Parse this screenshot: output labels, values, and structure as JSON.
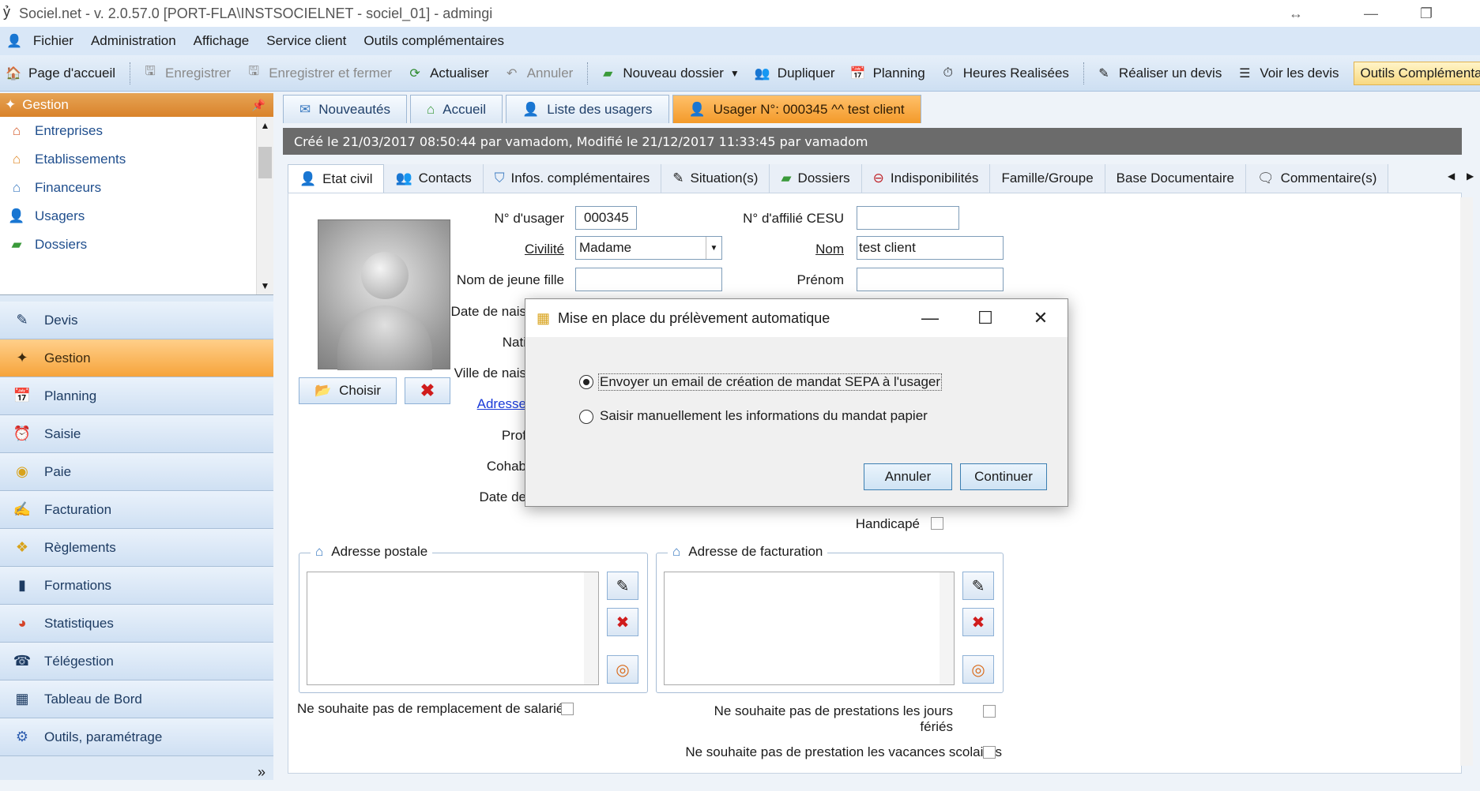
{
  "window": {
    "title": "Sociel.net - v. 2.0.57.0 [PORT-FLA\\INSTSOCIELNET - sociel_01] - admingi"
  },
  "menu": [
    "Fichier",
    "Administration",
    "Affichage",
    "Service client",
    "Outils complémentaires"
  ],
  "toolbar": {
    "home": "Page d'accueil",
    "save": "Enregistrer",
    "save_close": "Enregistrer et fermer",
    "refresh": "Actualiser",
    "cancel": "Annuler",
    "new_folder": "Nouveau dossier",
    "duplicate": "Dupliquer",
    "planning": "Planning",
    "hours": "Heures Realisées",
    "make_quote": "Réaliser un devis",
    "see_quotes": "Voir les devis",
    "tools": "Outils Complémentaires"
  },
  "sidebar": {
    "header": "Gestion",
    "items": [
      "Entreprises",
      "Etablissements",
      "Financeurs",
      "Usagers",
      "Dossiers"
    ],
    "nav": [
      "Devis",
      "Gestion",
      "Planning",
      "Saisie",
      "Paie",
      "Facturation",
      "Règlements",
      "Formations",
      "Statistiques",
      "Télégestion",
      "Tableau de Bord",
      "Outils, paramétrage"
    ],
    "active_nav": "Gestion"
  },
  "doc_tabs": [
    "Nouveautés",
    "Accueil",
    "Liste des usagers",
    "Usager N°: 000345 ^^ test client"
  ],
  "info_bar": "Créé le 21/03/2017 08:50:44 par vamadom, Modifié le 21/12/2017 11:33:45 par vamadom",
  "sub_tabs": [
    "Etat civil",
    "Contacts",
    "Infos. complémentaires",
    "Situation(s)",
    "Dossiers",
    "Indisponibilités",
    "Famille/Groupe",
    "Base Documentaire",
    "Commentaire(s)"
  ],
  "form": {
    "num_label": "N° d'usager",
    "num_value": "000345",
    "cesu_label": "N° d'affilié CESU",
    "cesu_value": "",
    "civ_label": "Civilité",
    "civ_value": "Madame",
    "nom_label": "Nom",
    "nom_value": "test client",
    "jf_label": "Nom de jeune fille",
    "prenom_label": "Prénom",
    "date_naiss_label": "Date de nais",
    "nat_label": "Nati",
    "ville_label": "Ville de nais",
    "adresse_link": "Adresse",
    "prof_label": "Prof",
    "cohab_label": "Cohab",
    "date_label": "Date de",
    "handicape_label": "Handicapé",
    "choose_btn": "Choisir"
  },
  "groups": {
    "postale": "Adresse postale",
    "facturation": "Adresse de facturation"
  },
  "checks": {
    "remplacement": "Ne souhaite pas de remplacement de salarié",
    "feries": "Ne souhaite pas de prestations les jours fériés",
    "vacances": "Ne souhaite pas de prestation les vacances scolaires"
  },
  "dialog": {
    "title": "Mise en place du prélèvement automatique",
    "option1": "Envoyer un email de création de mandat SEPA à l'usager",
    "option2": "Saisir manuellement les informations du mandat papier",
    "cancel": "Annuler",
    "continue": "Continuer"
  }
}
